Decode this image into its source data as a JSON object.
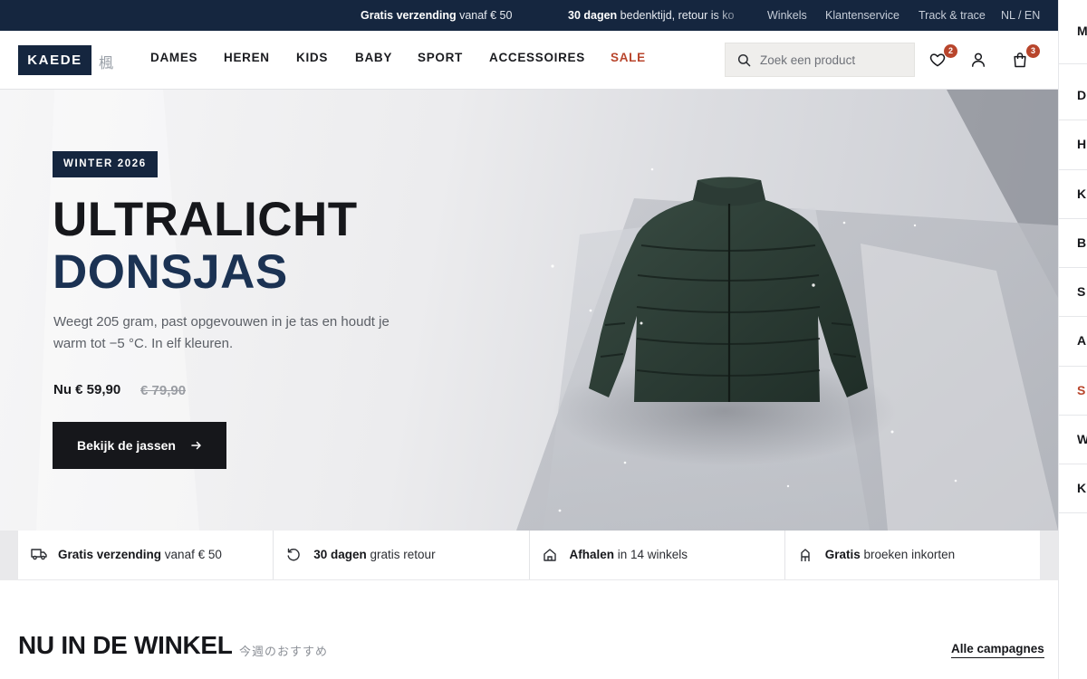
{
  "colors": {
    "navy": "#15263f",
    "accent_sale": "#b8452c",
    "ink": "#16171b",
    "headline_blue": "#1b3253"
  },
  "topbar": {
    "promo1_strong": "Gratis verzending",
    "promo1_rest": " vanaf € 50",
    "promo2_strong": "30 dagen",
    "promo2_rest": " bedenktijd, retour is ko",
    "links": [
      "Winkels",
      "Klantenservice",
      "Track & trace",
      "NL / EN"
    ]
  },
  "header": {
    "logo": "KAEDE",
    "logo_kanji": "楓",
    "nav": [
      "DAMES",
      "HEREN",
      "KIDS",
      "BABY",
      "SPORT",
      "ACCESSOIRES",
      "SALE"
    ],
    "search_placeholder": "Zoek een product",
    "wishlist_count": "2",
    "cart_count": "3",
    "icons": [
      "search-icon",
      "heart-icon",
      "user-icon",
      "bag-icon"
    ]
  },
  "hero": {
    "eyebrow": "WINTER 2026",
    "title_line1": "ULTRALICHT",
    "title_line2": "DONSJAS",
    "subtitle": "Weegt 205 gram, past opgevouwen in je tas en houdt je warm tot −5 °C. In elf kleuren.",
    "price": "Nu € 59,90",
    "old_price": "€ 79,90",
    "cta_label": "Bekijk de jassen",
    "cta_icon": "arrow-right-icon",
    "image": "green-puffer-jacket"
  },
  "usps": [
    {
      "icon": "truck-icon",
      "strong": "Gratis verzending",
      "rest": " vanaf € 50"
    },
    {
      "icon": "return-icon",
      "strong": "30 dagen",
      "rest": " gratis retour"
    },
    {
      "icon": "store-icon",
      "strong": "Afhalen",
      "rest": " in 14 winkels"
    },
    {
      "icon": "tailor-icon",
      "strong": "Gratis",
      "rest": " broeken inkorten"
    }
  ],
  "section": {
    "title": "NU IN DE WINKEL",
    "subtitle": "今週のおすすめ",
    "link": "Alle campagnes"
  },
  "side_menu_letters": [
    "M",
    "D",
    "H",
    "K",
    "B",
    "S",
    "A",
    "S",
    "W",
    "K"
  ]
}
